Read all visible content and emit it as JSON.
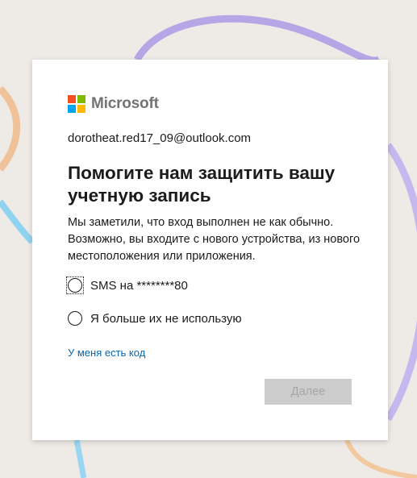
{
  "brand": {
    "name": "Microsoft",
    "colors": [
      "#f25022",
      "#7fba00",
      "#00a4ef",
      "#ffb900"
    ]
  },
  "account": {
    "email": "dorotheat.red17_09@outlook.com"
  },
  "page": {
    "title": "Помогите нам защитить вашу учетную запись",
    "description": "Мы заметили, что вход выполнен не как обычно. Возможно, вы входите с нового устройства, из нового местоположения или приложения."
  },
  "options": {
    "sms_label": "SMS на ********80",
    "other_label": "Я больше их не использую"
  },
  "links": {
    "have_code": "У меня есть код"
  },
  "actions": {
    "next_label": "Далее",
    "next_enabled": false
  },
  "colors": {
    "link": "#0067b8",
    "button_disabled_bg": "#cccccc",
    "button_disabled_text": "#a6a6a6"
  }
}
